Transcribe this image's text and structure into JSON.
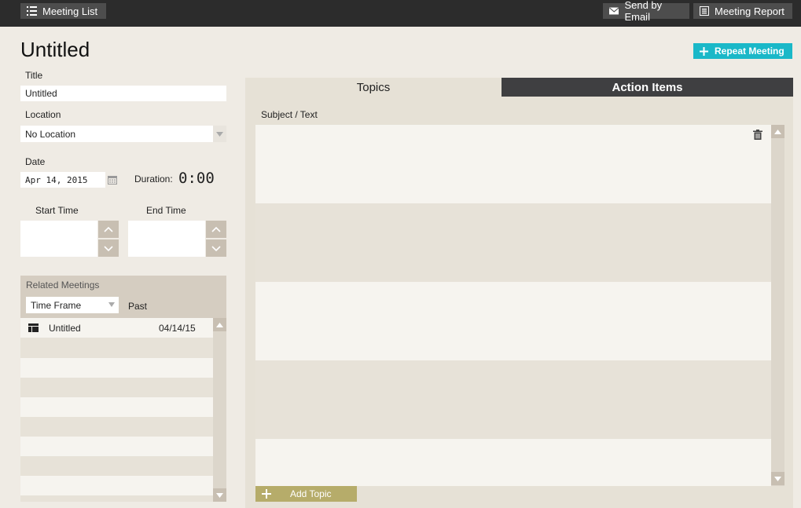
{
  "topbar": {
    "meeting_list": "Meeting List",
    "send_email": "Send by Email",
    "meeting_report": "Meeting Report"
  },
  "page": {
    "title": "Untitled",
    "repeat_meeting": "Repeat Meeting"
  },
  "form": {
    "title_label": "Title",
    "title_value": "Untitled",
    "location_label": "Location",
    "location_value": "No Location",
    "date_label": "Date",
    "date_value": "Apr 14, 2015",
    "duration_label": "Duration:",
    "duration_value": "0:00",
    "start_time_label": "Start Time",
    "end_time_label": "End Time"
  },
  "related": {
    "heading": "Related Meetings",
    "time_frame": "Time Frame",
    "time_frame_value": "Past",
    "items": [
      {
        "name": "Untitled",
        "date": "04/14/15"
      }
    ]
  },
  "tabs": {
    "topics": "Topics",
    "action_items": "Action Items"
  },
  "topics": {
    "column_header": "Subject / Text",
    "add_topic": "Add Topic"
  },
  "icons": {
    "list": "list-icon",
    "email": "envelope-icon",
    "report": "report-icon",
    "plus": "plus-icon",
    "calendar": "calendar-icon",
    "trash": "trash-icon",
    "meeting": "meeting-icon"
  },
  "colors": {
    "accent_cyan": "#1ab8c8",
    "add_topic_olive": "#b6ac6a",
    "topbar": "#2c2c2c",
    "tab_dark": "#3f3f41"
  }
}
